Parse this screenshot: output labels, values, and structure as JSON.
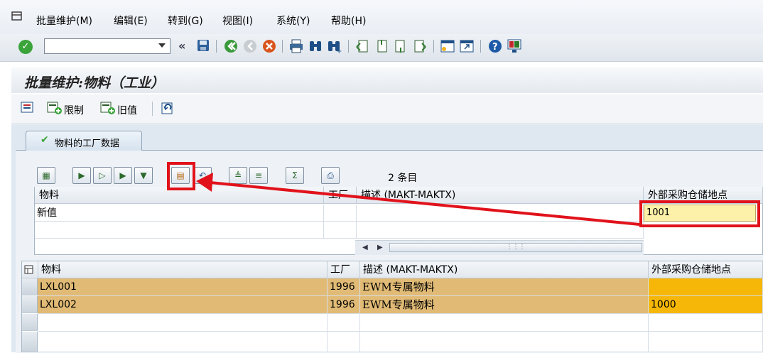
{
  "menu": {
    "items": [
      "批量维护(M)",
      "编辑(E)",
      "转到(G)",
      "视图(I)",
      "系统(Y)",
      "帮助(H)"
    ]
  },
  "toolbar": {
    "command_value": "",
    "back_label": "«"
  },
  "title": "批量维护:物料（工业）",
  "app_toolbar": {
    "restrict_label": "限制",
    "old_value_label": "旧值"
  },
  "tab": {
    "label": "物料的工厂数据"
  },
  "entries": "2 条目",
  "upper_grid": {
    "headers": [
      "物料",
      "工厂",
      "描述 (MAKT-MAKTX)",
      "外部采购仓储地点"
    ],
    "row_label": "新值",
    "new_value": "1001"
  },
  "lower_grid": {
    "headers": [
      "物料",
      "工厂",
      "描述 (MAKT-MAKTX)",
      "外部采购仓储地点"
    ],
    "rows": [
      {
        "material": "LXL001",
        "plant": "1996",
        "desc": "EWM专属物料",
        "storage": ""
      },
      {
        "material": "LXL002",
        "plant": "1996",
        "desc": "EWM专属物料",
        "storage": "1000"
      }
    ]
  },
  "colors": {
    "highlight_row": "#e1bb76",
    "highlight_cell": "#f7b708",
    "annotation": "#e1121b",
    "input_yellow": "#fdf0a8"
  }
}
